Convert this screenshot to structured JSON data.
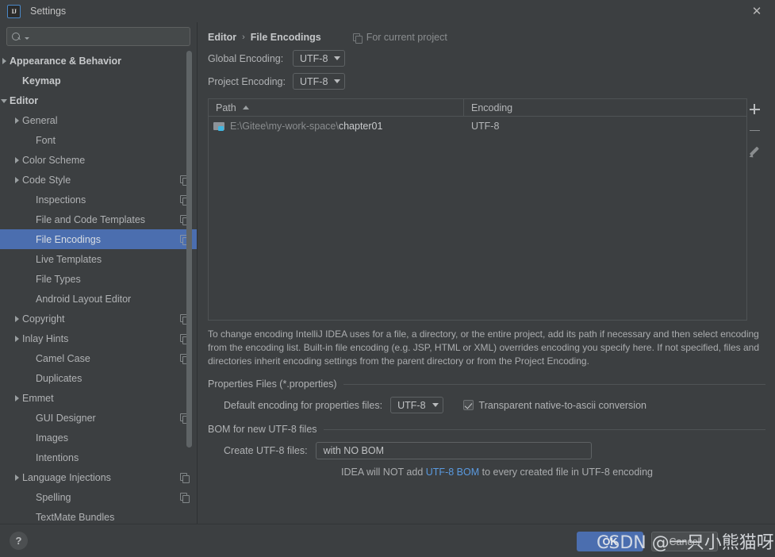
{
  "window": {
    "title": "Settings",
    "logo_text": "IJ",
    "close_label": "✕"
  },
  "search": {
    "value": "",
    "placeholder": ""
  },
  "sidebar": {
    "items": [
      {
        "label": "Appearance & Behavior",
        "arrow": "right",
        "indent": 10,
        "bold": true,
        "copy": false,
        "selected": false
      },
      {
        "label": "Keymap",
        "arrow": "none",
        "indent": 28,
        "bold": true,
        "copy": false,
        "selected": false
      },
      {
        "label": "Editor",
        "arrow": "down",
        "indent": 10,
        "bold": true,
        "copy": false,
        "selected": false
      },
      {
        "label": "General",
        "arrow": "right",
        "indent": 28,
        "bold": false,
        "copy": false,
        "selected": false
      },
      {
        "label": "Font",
        "arrow": "none",
        "indent": 45,
        "bold": false,
        "copy": false,
        "selected": false
      },
      {
        "label": "Color Scheme",
        "arrow": "right",
        "indent": 28,
        "bold": false,
        "copy": false,
        "selected": false
      },
      {
        "label": "Code Style",
        "arrow": "right",
        "indent": 28,
        "bold": false,
        "copy": true,
        "selected": false
      },
      {
        "label": "Inspections",
        "arrow": "none",
        "indent": 45,
        "bold": false,
        "copy": true,
        "selected": false
      },
      {
        "label": "File and Code Templates",
        "arrow": "none",
        "indent": 45,
        "bold": false,
        "copy": true,
        "selected": false
      },
      {
        "label": "File Encodings",
        "arrow": "none",
        "indent": 45,
        "bold": false,
        "copy": true,
        "selected": true
      },
      {
        "label": "Live Templates",
        "arrow": "none",
        "indent": 45,
        "bold": false,
        "copy": false,
        "selected": false
      },
      {
        "label": "File Types",
        "arrow": "none",
        "indent": 45,
        "bold": false,
        "copy": false,
        "selected": false
      },
      {
        "label": "Android Layout Editor",
        "arrow": "none",
        "indent": 45,
        "bold": false,
        "copy": false,
        "selected": false
      },
      {
        "label": "Copyright",
        "arrow": "right",
        "indent": 28,
        "bold": false,
        "copy": true,
        "selected": false
      },
      {
        "label": "Inlay Hints",
        "arrow": "right",
        "indent": 28,
        "bold": false,
        "copy": true,
        "selected": false
      },
      {
        "label": "Camel Case",
        "arrow": "none",
        "indent": 45,
        "bold": false,
        "copy": true,
        "selected": false
      },
      {
        "label": "Duplicates",
        "arrow": "none",
        "indent": 45,
        "bold": false,
        "copy": false,
        "selected": false
      },
      {
        "label": "Emmet",
        "arrow": "right",
        "indent": 28,
        "bold": false,
        "copy": false,
        "selected": false
      },
      {
        "label": "GUI Designer",
        "arrow": "none",
        "indent": 45,
        "bold": false,
        "copy": true,
        "selected": false
      },
      {
        "label": "Images",
        "arrow": "none",
        "indent": 45,
        "bold": false,
        "copy": false,
        "selected": false
      },
      {
        "label": "Intentions",
        "arrow": "none",
        "indent": 45,
        "bold": false,
        "copy": false,
        "selected": false
      },
      {
        "label": "Language Injections",
        "arrow": "right",
        "indent": 28,
        "bold": false,
        "copy": true,
        "selected": false
      },
      {
        "label": "Spelling",
        "arrow": "none",
        "indent": 45,
        "bold": false,
        "copy": true,
        "selected": false
      },
      {
        "label": "TextMate Bundles",
        "arrow": "none",
        "indent": 45,
        "bold": false,
        "copy": false,
        "selected": false
      }
    ]
  },
  "main": {
    "breadcrumb": {
      "parent": "Editor",
      "separator": "›",
      "current": "File Encodings"
    },
    "for_current_project": "For current project",
    "global_encoding": {
      "label": "Global Encoding:",
      "value": "UTF-8"
    },
    "project_encoding": {
      "label": "Project Encoding:",
      "value": "UTF-8"
    },
    "table": {
      "columns": [
        "Path",
        "Encoding"
      ],
      "sort_column": "Path",
      "sort_direction": "asc",
      "rows": [
        {
          "path_prefix": "E:\\Gitee\\my-work-space\\",
          "path_leaf": "chapter01",
          "encoding": "UTF-8"
        }
      ],
      "buttons": {
        "add": "+",
        "remove": "−",
        "edit": "pencil"
      }
    },
    "description": "To change encoding IntelliJ IDEA uses for a file, a directory, or the entire project, add its path if necessary and then select encoding from the encoding list. Built-in file encoding (e.g. JSP, HTML or XML) overrides encoding you specify here. If not specified, files and directories inherit encoding settings from the parent directory or from the Project Encoding.",
    "properties_group": {
      "title": "Properties Files (*.properties)",
      "default_encoding_label": "Default encoding for properties files:",
      "default_encoding_value": "UTF-8",
      "transparent_label": "Transparent native-to-ascii conversion",
      "transparent_checked": true
    },
    "bom_group": {
      "title": "BOM for new UTF-8 files",
      "create_label": "Create UTF-8 files:",
      "create_value": "with NO BOM",
      "note_before": "IDEA will NOT add ",
      "note_link": "UTF-8 BOM",
      "note_after": " to every created file in UTF-8 encoding"
    }
  },
  "footer": {
    "help": "?",
    "ok": "OK",
    "cancel": "Cancel"
  },
  "watermark": {
    "text": "CSDN @一只小熊猫呀"
  },
  "colors": {
    "background": "#3c3f41",
    "selection": "#4b6eaf",
    "accent_link": "#5a9ae0",
    "folder_badge": "#40b6e0"
  }
}
